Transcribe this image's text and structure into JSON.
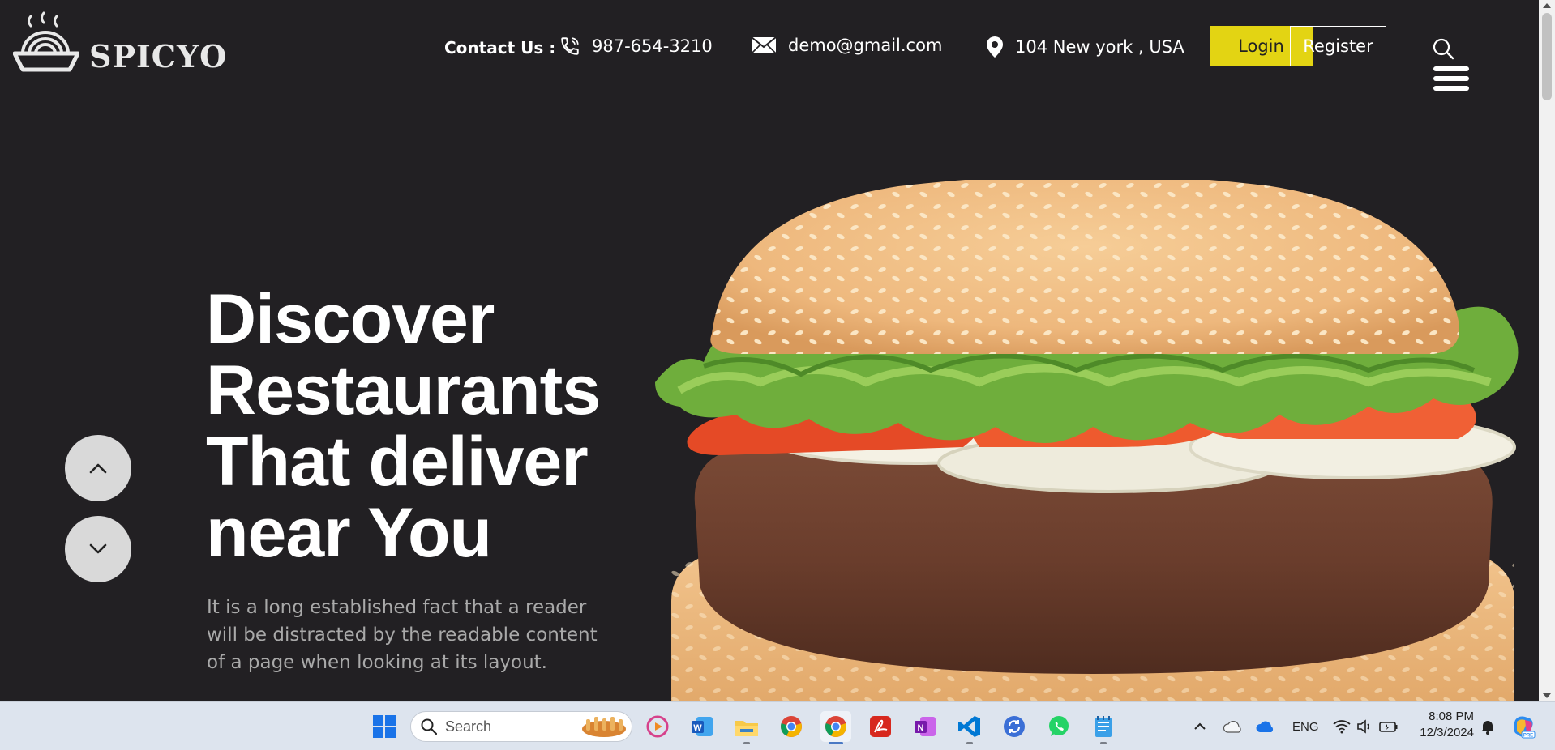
{
  "brand": {
    "name": "SPICYO",
    "logo_icon": "steaming-bowl-icon"
  },
  "contact": {
    "label": "Contact Us :",
    "phone": "987-654-3210",
    "email": "demo@gmail.com",
    "location": "104 New york , USA",
    "icons": [
      "phone-icon",
      "mail-icon",
      "location-pin-icon"
    ]
  },
  "auth": {
    "login_label": "Login",
    "register_label": "Register"
  },
  "header_icons": [
    "search-icon",
    "hamburger-menu-icon"
  ],
  "hero": {
    "title_lines": [
      "Discover",
      "Restaurants",
      "That deliver",
      "near You"
    ],
    "description": "It is a long established fact that a reader will be distracted by the readable content of a page when looking at its layout.",
    "image": "burger-image",
    "slider_controls": [
      "chevron-up-icon",
      "chevron-down-icon"
    ]
  },
  "colors": {
    "background": "#222023",
    "accent_login": "#e3d413",
    "text_primary": "#ffffff",
    "text_muted": "#a9a9a9"
  },
  "taskbar": {
    "search_placeholder": "Search",
    "apps": [
      "windows-start-icon",
      "media-player-icon",
      "word-icon",
      "file-explorer-icon",
      "chrome-icon",
      "chrome-active-icon",
      "acrobat-icon",
      "onenote-icon",
      "vscode-icon",
      "sync-icon",
      "whatsapp-icon",
      "notepad-icon"
    ],
    "language": "ENG",
    "time": "8:08 PM",
    "date": "12/3/2024"
  }
}
